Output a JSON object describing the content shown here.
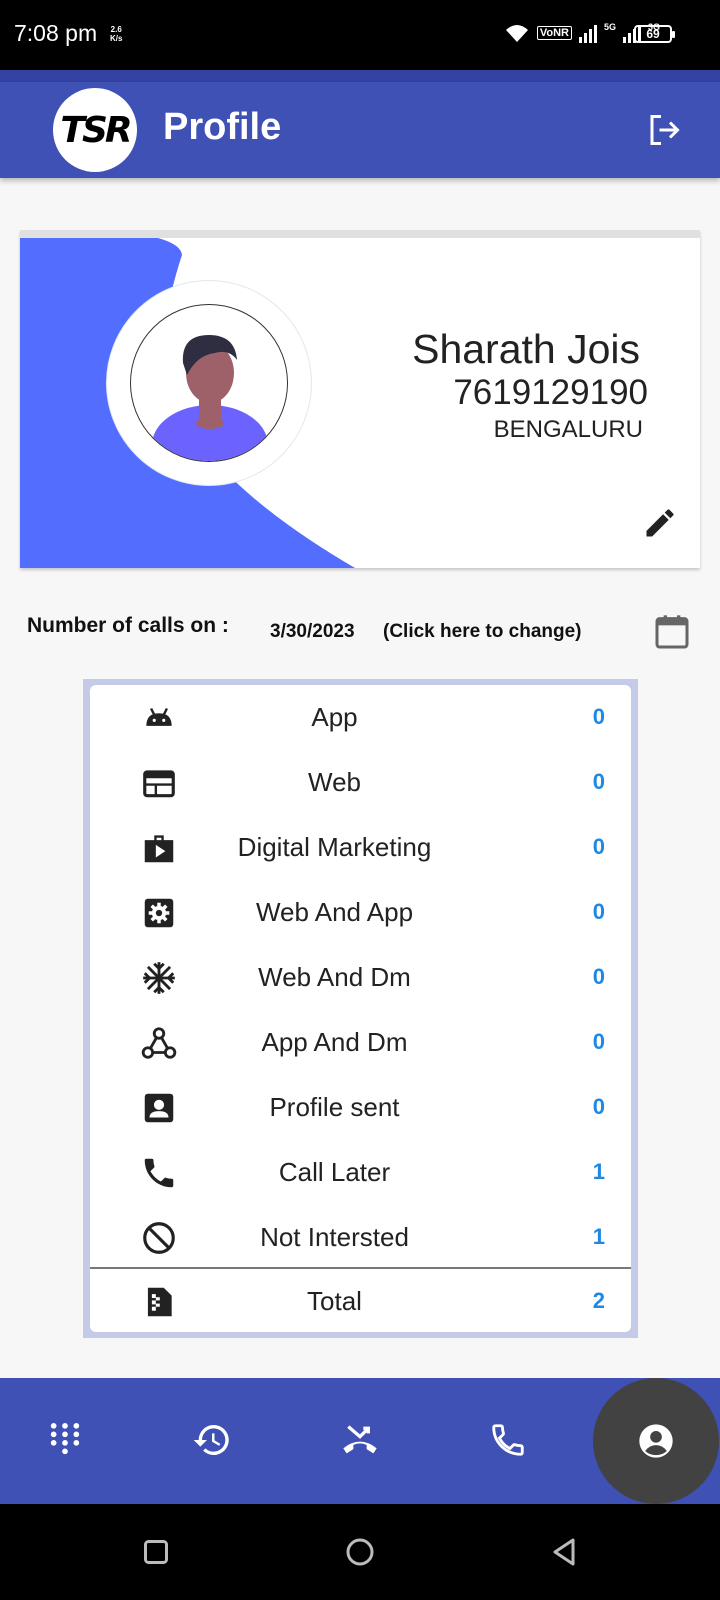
{
  "status_bar": {
    "time": "7:08 pm",
    "speed_value": "2.6",
    "speed_unit": "K/s",
    "vonr": "VoNR",
    "net1": "5G",
    "net2": "3G",
    "battery": "69"
  },
  "header": {
    "logo_text": "TSR",
    "title": "Profile"
  },
  "profile": {
    "name": "Sharath Jois",
    "phone": "7619129190",
    "city": "BENGALURU"
  },
  "calls": {
    "label": "Number of calls on :",
    "date": "3/30/2023",
    "change_hint": "(Click here to change)"
  },
  "stats": [
    {
      "icon": "android-icon",
      "label": "App",
      "value": "0"
    },
    {
      "icon": "web-icon",
      "label": "Web",
      "value": "0"
    },
    {
      "icon": "video-case-icon",
      "label": "Digital Marketing",
      "value": "0"
    },
    {
      "icon": "settings-box-icon",
      "label": "Web And App",
      "value": "0"
    },
    {
      "icon": "snowflake-icon",
      "label": "Web And Dm",
      "value": "0"
    },
    {
      "icon": "webhook-icon",
      "label": "App And Dm",
      "value": "0"
    },
    {
      "icon": "contact-card-icon",
      "label": "Profile sent",
      "value": "0"
    },
    {
      "icon": "phone-icon",
      "label": "Call Later",
      "value": "1"
    },
    {
      "icon": "block-icon",
      "label": "Not Intersted",
      "value": "1"
    }
  ],
  "total": {
    "icon": "file-icon",
    "label": "Total",
    "value": "2"
  },
  "colors": {
    "primary": "#3f51b5",
    "accent_blue": "#536dfe",
    "value_blue": "#1e88e5",
    "active_nav": "#424242"
  },
  "bottom_nav": [
    "dialpad-icon",
    "history-icon",
    "missed-call-icon",
    "phone-icon",
    "account-icon"
  ],
  "active_nav": "account-icon"
}
